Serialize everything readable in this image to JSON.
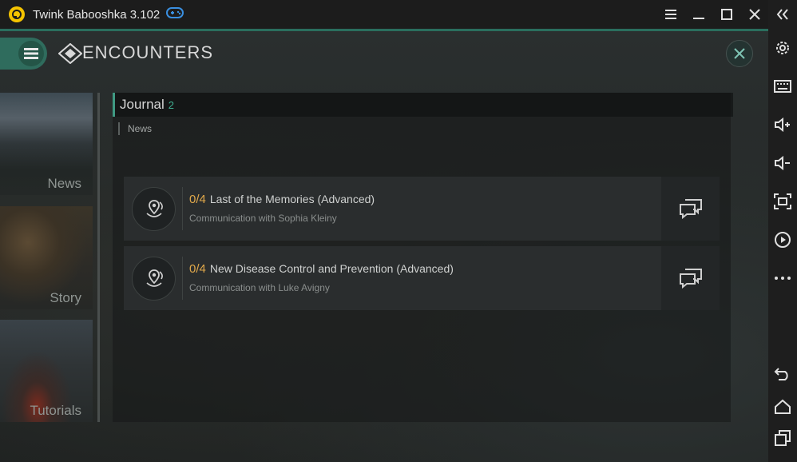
{
  "window": {
    "title": "Twink Babooshka 3.102",
    "icons": [
      "app-logo-icon",
      "gamepad-icon",
      "menu-icon",
      "minimize-icon",
      "maximize-icon",
      "close-icon"
    ]
  },
  "sidebar": {
    "items": [
      "collapse-icon",
      "settings-icon",
      "keyboard-icon",
      "volume-up-icon",
      "volume-down-icon",
      "screenshot-icon",
      "record-icon",
      "more-icon",
      "back-icon",
      "home-icon",
      "recents-icon"
    ]
  },
  "game": {
    "header": {
      "title": "ENCOUNTERS"
    },
    "tabs": [
      {
        "label": "News"
      },
      {
        "label": "Story"
      },
      {
        "label": "Tutorials"
      }
    ],
    "journal": {
      "title": "Journal",
      "count": "2",
      "section": "News",
      "entries": [
        {
          "progress": "0/4",
          "title": "Last of the Memories (Advanced)",
          "subtitle": "Communication with Sophia Kleiny"
        },
        {
          "progress": "0/4",
          "title": "New Disease Control and Prevention (Advanced)",
          "subtitle": "Communication with Luke Avigny"
        }
      ]
    }
  },
  "colors": {
    "accent": "#2f6c5d",
    "progress": "#e0a84a",
    "count": "#3fae90"
  }
}
